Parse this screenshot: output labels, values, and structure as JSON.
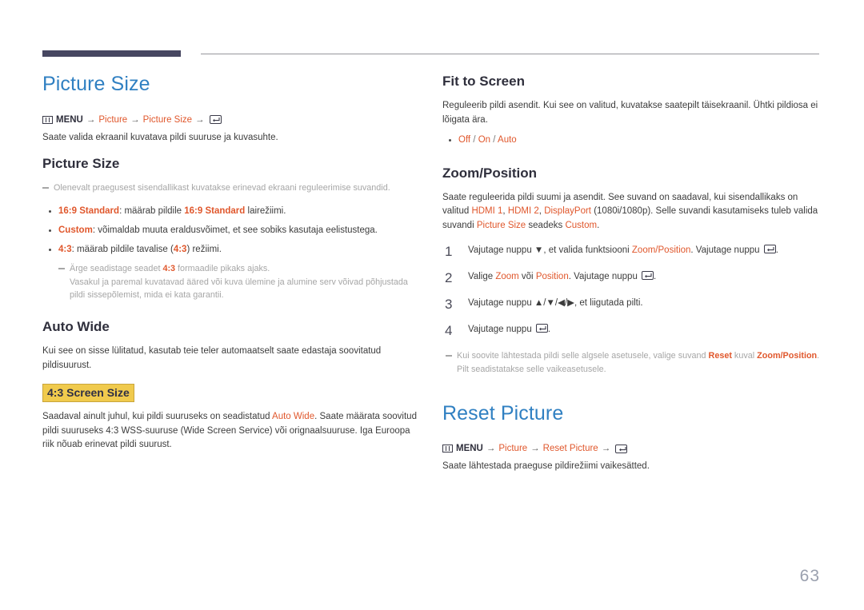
{
  "page": {
    "number": "63",
    "accent_blue": "#3080c2",
    "accent_orange": "#e0572c",
    "highlight_yellow": "#f0ca4d",
    "rule_dark": "#474761"
  },
  "icons": {
    "menu": "menu-grid-icon",
    "enter": "enter-key-icon",
    "arrow_right": "→",
    "arrow_up": "▲",
    "arrow_down": "▼",
    "arrow_left": "◀",
    "arrow_right_solid": "▶"
  },
  "left_column": {
    "chapter_title": "Picture Size",
    "menu_path": {
      "menu_label": "MENU",
      "items": [
        "Picture",
        "Picture Size"
      ]
    },
    "intro": "Saate valida ekraanil kuvatava pildi suuruse ja kuvasuhte.",
    "section_picture_size": {
      "heading": "Picture Size",
      "note": "Olenevalt praegusest sisendallikast kuvatakse erinevad ekraani reguleerimise suvandid.",
      "bullets": [
        {
          "term": "16:9 Standard",
          "text_before": ": määrab pildile ",
          "inline_term": "16:9 Standard",
          "text_after": " lairežiimi."
        },
        {
          "term": "Custom",
          "text_before": ": võimaldab muuta eraldusvõimet, et see sobiks kasutaja eelistustega.",
          "inline_term": "",
          "text_after": ""
        },
        {
          "term": "4:3",
          "text_before": ": määrab pildile tavalise (",
          "inline_term": "4:3",
          "text_after": ") režiimi."
        }
      ],
      "sub_note_line1_a": "Ärge seadistage seadet ",
      "sub_note_term": "4:3",
      "sub_note_line1_b": " formaadile pikaks ajaks.",
      "sub_note_line2": "Vasakul ja paremal kuvatavad ääred või kuva ülemine ja alumine serv võivad põhjustada pildi sissepõlemist, mida ei kata garantii."
    },
    "section_auto_wide": {
      "heading": "Auto Wide",
      "body": "Kui see on sisse lülitatud, kasutab teie teler automaatselt saate edastaja soovitatud pildisuurust."
    },
    "section_43_screen_size": {
      "heading": "4:3 Screen Size",
      "body_a": "Saadaval ainult juhul, kui pildi suuruseks on seadistatud ",
      "body_term": "Auto Wide",
      "body_b": ". Saate määrata soovitud pildi suuruseks 4:3 WSS-suuruse (Wide Screen Service) või orignaalsuuruse. Iga Euroopa riik nõuab erinevat pildi suurust."
    }
  },
  "right_column": {
    "section_fit_to_screen": {
      "heading": "Fit to Screen",
      "body": "Reguleerib pildi asendit. Kui see on valitud, kuvatakse saatepilt täisekraanil. Ühtki pildiosa ei lõigata ära.",
      "options": [
        "Off",
        "On",
        "Auto"
      ]
    },
    "section_zoom_position": {
      "heading": "Zoom/Position",
      "body_a": "Saate reguleerida pildi suumi ja asendit. See suvand on saadaval, kui sisendallikaks on valitud ",
      "body_sources": [
        "HDMI 1",
        "HDMI 2",
        "DisplayPort"
      ],
      "body_b": " (1080i/1080p). Selle suvandi kasutamiseks tuleb valida suvandi ",
      "body_term_picture_size": "Picture Size",
      "body_c": " seadeks ",
      "body_term_custom": "Custom",
      "body_d": ".",
      "steps": [
        {
          "num": "1",
          "a": "Vajutage nuppu ",
          "glyph": "▼",
          "b": ", et valida funktsiooni ",
          "term": "Zoom/Position",
          "c": ". Vajutage nuppu ",
          "d": "."
        },
        {
          "num": "2",
          "a": "Valige ",
          "term": "Zoom",
          "b": " või ",
          "term2": "Position",
          "c": ". Vajutage nuppu ",
          "d": "."
        },
        {
          "num": "3",
          "a": "Vajutage nuppu ",
          "glyph": "▲/▼/◀/▶",
          "b": ", et liigutada pilti."
        },
        {
          "num": "4",
          "a": "Vajutage nuppu ",
          "d": "."
        }
      ],
      "note_a": "Kui soovite lähtestada pildi selle algsele asetusele, valige suvand ",
      "note_term_reset": "Reset",
      "note_b": " kuval ",
      "note_term_zoom": "Zoom/Position",
      "note_c": ". Pilt seadistatakse selle vaikeasetusele."
    },
    "section_reset_picture": {
      "chapter_title": "Reset Picture",
      "menu_path": {
        "menu_label": "MENU",
        "items": [
          "Picture",
          "Reset Picture"
        ]
      },
      "body": "Saate lähtestada praeguse pildirežiimi vaikesätted."
    }
  }
}
